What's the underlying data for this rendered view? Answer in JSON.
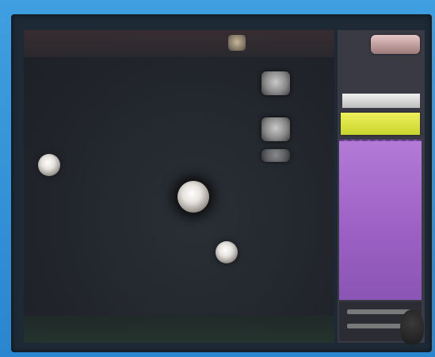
{
  "sidebar": {
    "score_label": "",
    "meter1_value": "",
    "meter2_value": "",
    "meter1_fill": 0.95,
    "meter2_fill": 0.98
  },
  "colors": {
    "outer": "#2f8fd4",
    "playfield": "#22262c",
    "sidebar": "#3a3a44",
    "meter_white": "#e6e6e6",
    "meter_yellow": "#e2e84a",
    "meter_purple": "#a46bcf",
    "orb": "#f4f1ee"
  },
  "icons": {
    "orbs": [
      "orb-icon",
      "orb-icon",
      "orb-icon",
      "orb-icon"
    ],
    "blocks": [
      "block-icon",
      "block-icon",
      "block-icon"
    ]
  }
}
